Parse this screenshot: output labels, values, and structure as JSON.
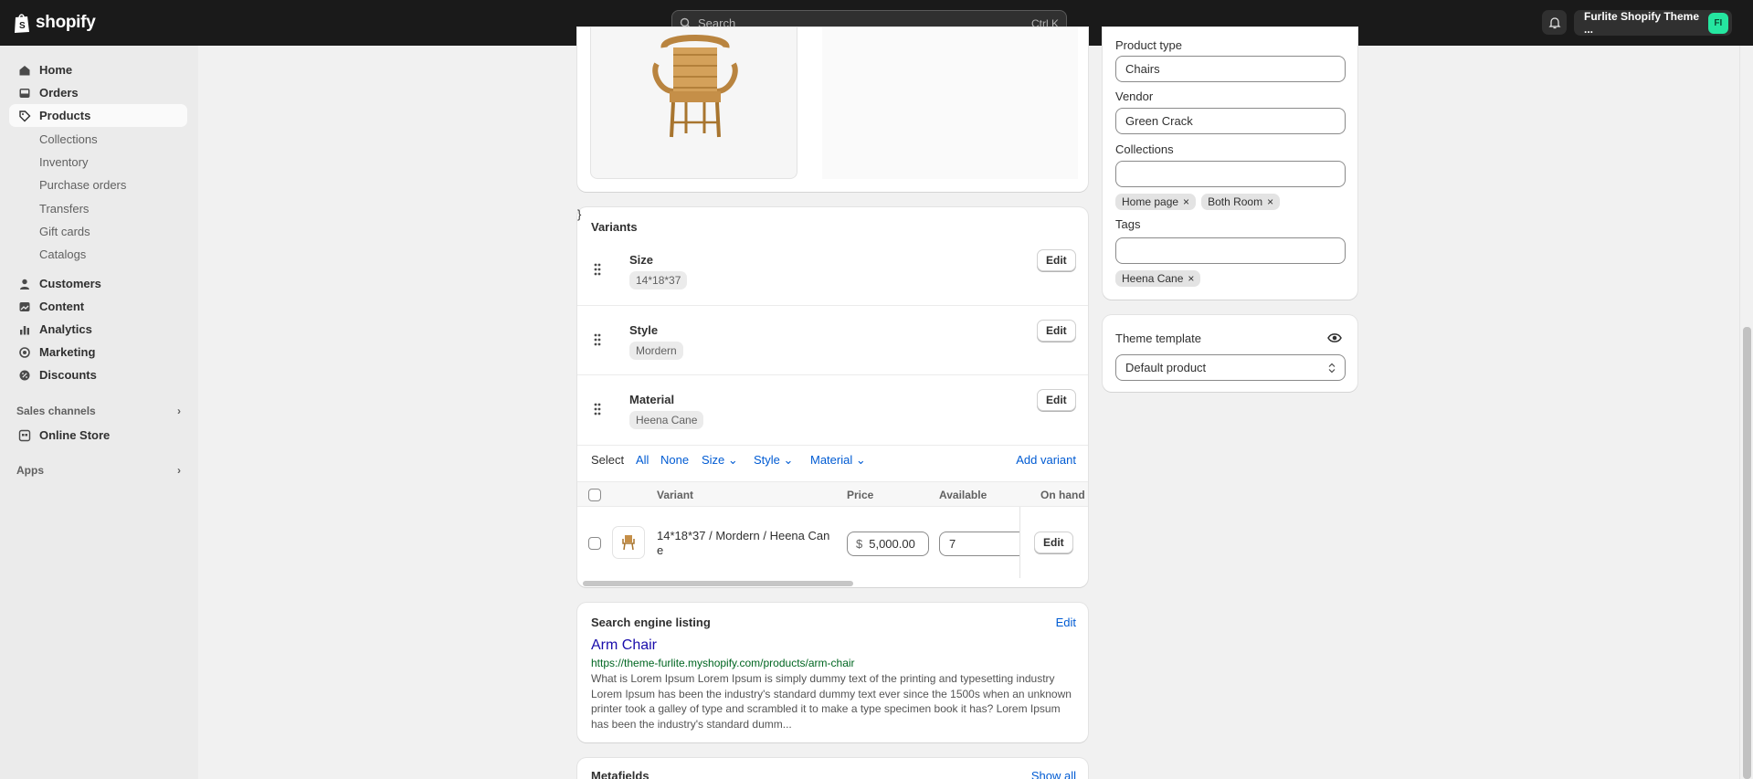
{
  "topbar": {
    "logo_text": "shopify",
    "search_placeholder": "Search",
    "search_shortcut": "Ctrl K",
    "store_name": "Furlite Shopify Theme ...",
    "store_initials": "FI"
  },
  "sidebar": {
    "items": [
      {
        "label": "Home",
        "icon": "home-icon"
      },
      {
        "label": "Orders",
        "icon": "inbox-icon"
      },
      {
        "label": "Products",
        "icon": "tag-icon"
      }
    ],
    "product_subitems": [
      "Collections",
      "Inventory",
      "Purchase orders",
      "Transfers",
      "Gift cards",
      "Catalogs"
    ],
    "more_items": [
      {
        "label": "Customers",
        "icon": "person-icon"
      },
      {
        "label": "Content",
        "icon": "content-icon"
      },
      {
        "label": "Analytics",
        "icon": "bar-chart-icon"
      },
      {
        "label": "Marketing",
        "icon": "target-icon"
      },
      {
        "label": "Discounts",
        "icon": "discount-icon"
      }
    ],
    "sales_channels_label": "Sales channels",
    "online_store_label": "Online Store",
    "apps_label": "Apps"
  },
  "organization": {
    "product_type_label": "Product type",
    "product_type_value": "Chairs",
    "vendor_label": "Vendor",
    "vendor_value": "Green Crack",
    "collections_label": "Collections",
    "collections_chips": [
      "Home page",
      "Both Room"
    ],
    "tags_label": "Tags",
    "tags_chips": [
      "Heena Cane"
    ]
  },
  "theme_template": {
    "label": "Theme template",
    "value": "Default product"
  },
  "variants": {
    "title": "Variants",
    "options": [
      {
        "name": "Size",
        "value": "14*18*37",
        "edit": "Edit"
      },
      {
        "name": "Style",
        "value": "Mordern",
        "edit": "Edit"
      },
      {
        "name": "Material",
        "value": "Heena Cane",
        "edit": "Edit"
      }
    ],
    "select_label": "Select",
    "select_all": "All",
    "select_none": "None",
    "filter_size": "Size",
    "filter_style": "Style",
    "filter_material": "Material",
    "add_variant": "Add variant",
    "columns": {
      "variant": "Variant",
      "price": "Price",
      "available": "Available",
      "on_hand": "On hand"
    },
    "rows": [
      {
        "name_line1": "14*18*37 / Mordern / Heena Can",
        "name_line2": "e",
        "currency": "$",
        "price": "5,000.00",
        "available": "7",
        "edit": "Edit"
      }
    ]
  },
  "seo": {
    "title": "Search engine listing",
    "edit": "Edit",
    "page_title": "Arm Chair",
    "url": "https://theme-furlite.myshopify.com/products/arm-chair",
    "description": "What is Lorem Ipsum Lorem Ipsum is simply dummy text of the printing and typesetting industry Lorem Ipsum has been the industry's standard dummy text ever since the 1500s when an unknown printer took a galley of type and scrambled it to make a type specimen book it has? Lorem Ipsum has been the industry's standard dumm..."
  },
  "metafields": {
    "title": "Metafields",
    "show_all": "Show all"
  }
}
